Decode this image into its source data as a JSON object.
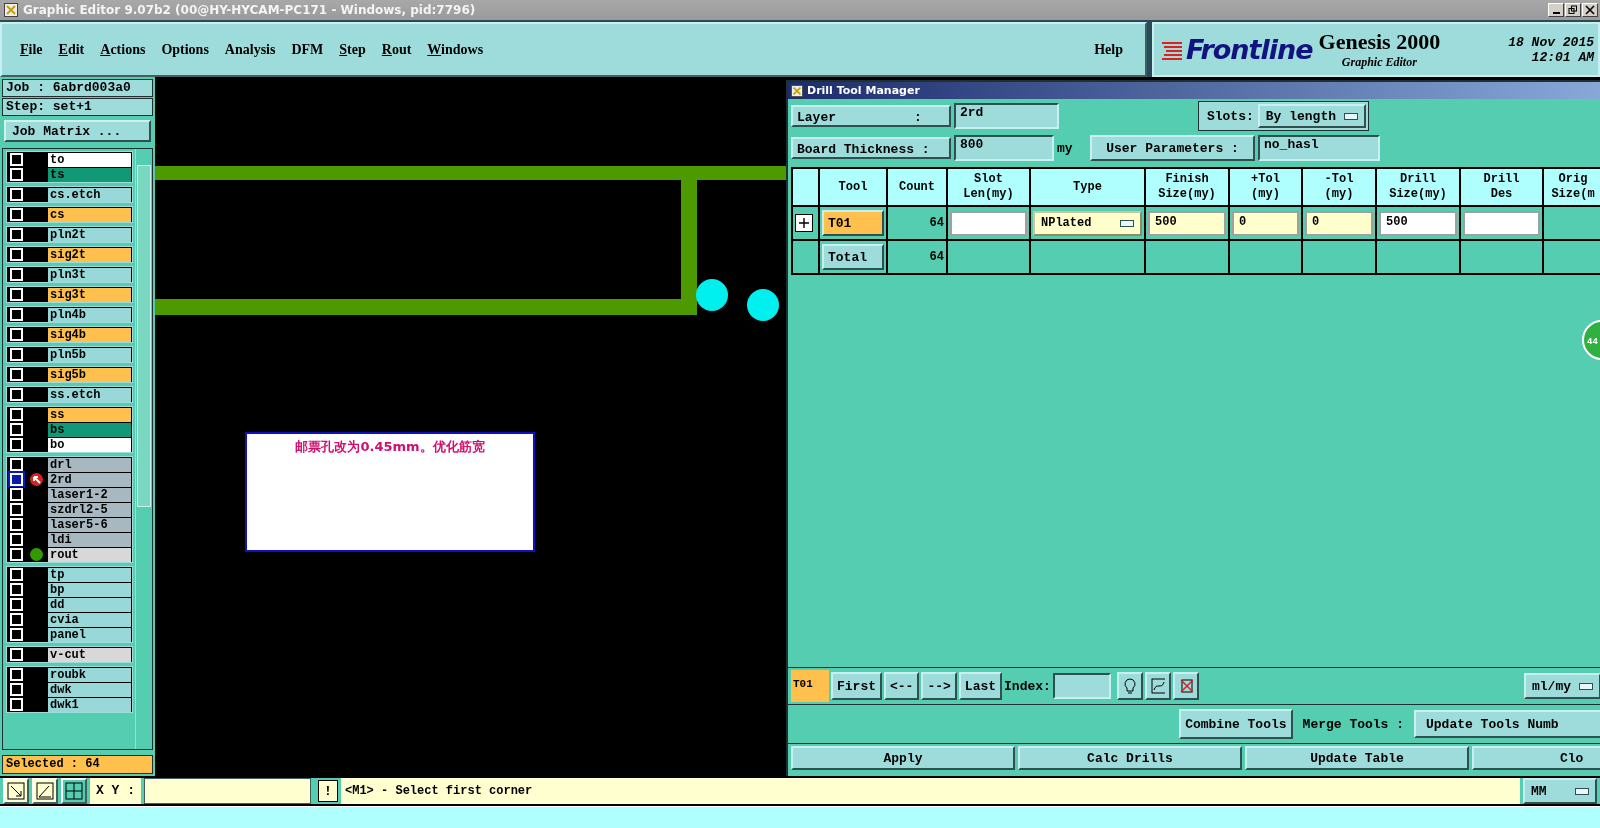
{
  "window": {
    "title": "Graphic Editor 9.07b2 (00@HY-HYCAM-PC171 - Windows, pid:7796)"
  },
  "menu": [
    {
      "label": "File",
      "underlined": true
    },
    {
      "label": "Edit",
      "underlined": true
    },
    {
      "label": "Actions",
      "underlined": true
    },
    {
      "label": "Options",
      "underlined": false
    },
    {
      "label": "Analysis",
      "underlined": false
    },
    {
      "label": "DFM",
      "underlined": false
    },
    {
      "label": "Step",
      "underlined": true
    },
    {
      "label": "Rout",
      "underlined": true
    },
    {
      "label": "Windows",
      "underlined": true
    }
  ],
  "help": "Help",
  "logo": {
    "brand": "Frontline",
    "product": "Genesis 2000",
    "subtitle": "Graphic Editor",
    "date": "18 Nov 2015",
    "time": "12:01 AM"
  },
  "job_panel": {
    "job": "Job : 6abrd003a0",
    "step": "Step: set+1",
    "matrix_button": "Job Matrix ...",
    "layer_groups": [
      [
        {
          "name": "to",
          "color": "#ffffff",
          "selected": false,
          "kind": "plain"
        },
        {
          "name": "ts",
          "color": "#119977",
          "selected": false,
          "kind": "plain"
        }
      ],
      [
        {
          "name": "cs.etch",
          "color": "#99d8d8",
          "selected": false,
          "kind": "plain"
        }
      ],
      [
        {
          "name": "cs",
          "color": "#ffc04d",
          "selected": false,
          "kind": "plain"
        }
      ],
      [
        {
          "name": "pln2t",
          "color": "#99d8d8",
          "selected": false,
          "kind": "plain"
        }
      ],
      [
        {
          "name": "sig2t",
          "color": "#ffc04d",
          "selected": false,
          "kind": "plain"
        }
      ],
      [
        {
          "name": "pln3t",
          "color": "#99d8d8",
          "selected": false,
          "kind": "plain"
        }
      ],
      [
        {
          "name": "sig3t",
          "color": "#ffc04d",
          "selected": false,
          "kind": "plain"
        }
      ],
      [
        {
          "name": "pln4b",
          "color": "#99d8d8",
          "selected": false,
          "kind": "plain"
        }
      ],
      [
        {
          "name": "sig4b",
          "color": "#ffc04d",
          "selected": false,
          "kind": "plain"
        }
      ],
      [
        {
          "name": "pln5b",
          "color": "#99d8d8",
          "selected": false,
          "kind": "plain"
        }
      ],
      [
        {
          "name": "sig5b",
          "color": "#ffc04d",
          "selected": false,
          "kind": "plain"
        }
      ],
      [
        {
          "name": "ss.etch",
          "color": "#99d8d8",
          "selected": false,
          "kind": "plain"
        }
      ],
      [
        {
          "name": "ss",
          "color": "#ffc04d",
          "selected": false,
          "kind": "plain"
        },
        {
          "name": "bs",
          "color": "#119977",
          "selected": false,
          "kind": "plain"
        },
        {
          "name": "bo",
          "color": "#ffffff",
          "selected": false,
          "kind": "plain"
        }
      ],
      [
        {
          "name": "drl",
          "color": "#a8b8c0",
          "selected": false,
          "kind": "plain"
        },
        {
          "name": "2rd",
          "color": "#a8b8c0",
          "selected": true,
          "kind": "work"
        },
        {
          "name": "laser1-2",
          "color": "#a8b8c0",
          "selected": false,
          "kind": "plain"
        },
        {
          "name": "szdrl2-5",
          "color": "#a8b8c0",
          "selected": false,
          "kind": "plain"
        },
        {
          "name": "laser5-6",
          "color": "#a8b8c0",
          "selected": false,
          "kind": "plain"
        },
        {
          "name": "ldi",
          "color": "#a8b8c0",
          "selected": false,
          "kind": "plain"
        },
        {
          "name": "rout",
          "color": "#d8d8d8",
          "selected": false,
          "kind": "affected"
        }
      ],
      [
        {
          "name": "tp",
          "color": "#99d8d8",
          "selected": false,
          "kind": "plain"
        },
        {
          "name": "bp",
          "color": "#99d8d8",
          "selected": false,
          "kind": "plain"
        },
        {
          "name": "dd",
          "color": "#99d8d8",
          "selected": false,
          "kind": "plain"
        },
        {
          "name": "cvia",
          "color": "#99d8d8",
          "selected": false,
          "kind": "plain"
        },
        {
          "name": "panel",
          "color": "#99d8d8",
          "selected": false,
          "kind": "plain"
        }
      ],
      [
        {
          "name": "v-cut",
          "color": "#d8d8d8",
          "selected": false,
          "kind": "plain"
        }
      ],
      [
        {
          "name": "roubk",
          "color": "#99d8d8",
          "selected": false,
          "kind": "plain"
        },
        {
          "name": "dwk",
          "color": "#99d8d8",
          "selected": false,
          "kind": "plain"
        },
        {
          "name": "dwk1",
          "color": "#99d8d8",
          "selected": false,
          "kind": "plain"
        }
      ]
    ],
    "selected_count": "Selected : 64"
  },
  "canvas": {
    "note": "邮票孔改为0.45mm。优化筋宽",
    "badge": "44"
  },
  "drill_tool_manager": {
    "title": "Drill Tool Manager",
    "layer_label": "Layer          :",
    "layer_value": "2rd",
    "slots_label": "Slots:",
    "slots_value": "By length",
    "thickness_label": "Board Thickness :",
    "thickness_value": "800",
    "thickness_unit": "my",
    "user_params_button": "User Parameters :",
    "user_params_value": "no_hasl",
    "columns": [
      {},
      {
        "lines": [
          "Tool"
        ]
      },
      {
        "lines": [
          "Count"
        ]
      },
      {
        "lines": [
          "Slot",
          "Len(my)"
        ]
      },
      {
        "lines": [
          "Type"
        ]
      },
      {
        "lines": [
          "Finish",
          "Size(my)"
        ]
      },
      {
        "lines": [
          "+Tol",
          "(my)"
        ]
      },
      {
        "lines": [
          "-Tol",
          "(my)"
        ]
      },
      {
        "lines": [
          "Drill",
          "Size(my)"
        ]
      },
      {
        "lines": [
          "Drill",
          "Des"
        ]
      },
      {
        "lines": [
          "Orig",
          "Size(m"
        ]
      }
    ],
    "rows": [
      {
        "cells": [
          {
            "kind": "expander"
          },
          {
            "kind": "tool",
            "value": "T01",
            "selected": true
          },
          {
            "kind": "count",
            "value": "64"
          },
          {
            "kind": "field",
            "highlighted": false
          },
          {
            "kind": "dropdown",
            "value": "NPlated",
            "highlighted": true
          },
          {
            "kind": "field",
            "value": "500",
            "highlighted": true
          },
          {
            "kind": "field",
            "value": "0",
            "highlighted": true
          },
          {
            "kind": "field",
            "value": "0",
            "highlighted": true
          },
          {
            "kind": "field",
            "value": "500",
            "highlighted": false
          },
          {
            "kind": "field",
            "highlighted": false
          },
          {
            "kind": "empty"
          }
        ]
      },
      {
        "cells": [
          {
            "kind": "empty"
          },
          {
            "kind": "tool",
            "value": "Total",
            "selected": false
          },
          {
            "kind": "count",
            "value": "64"
          },
          {
            "kind": "empty"
          },
          {
            "kind": "empty"
          },
          {
            "kind": "empty"
          },
          {
            "kind": "empty"
          },
          {
            "kind": "empty"
          },
          {
            "kind": "empty"
          },
          {
            "kind": "empty"
          },
          {
            "kind": "empty"
          }
        ]
      }
    ],
    "current_tool": "T01",
    "nav_buttons": [
      "First",
      "<--",
      "-->",
      "Last"
    ],
    "index_label": "Index:",
    "units": "ml/my",
    "combine_button": "Combine Tools",
    "merge_label": "Merge Tools :",
    "update_numbers_button": "Update Tools Numb",
    "actions": [
      "Apply",
      "Calc Drills",
      "Update Table",
      "Clo"
    ]
  },
  "status_bar": {
    "xy_label": "X Y :",
    "message": "<M1> - Select first corner",
    "units": "MM",
    "alert": "!"
  }
}
